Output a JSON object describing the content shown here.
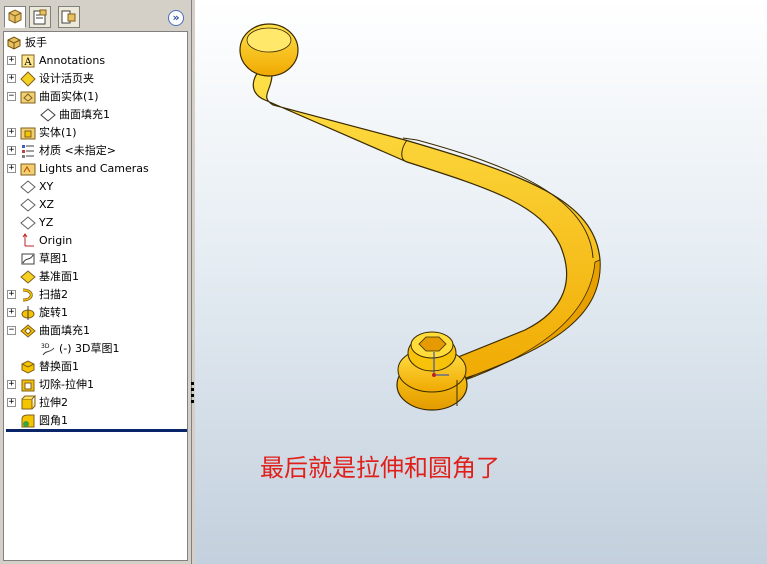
{
  "tabs": [
    {
      "icon": "feature-tree-icon"
    },
    {
      "icon": "property-manager-icon"
    },
    {
      "icon": "configuration-manager-icon"
    }
  ],
  "collapse_label": "»",
  "tree": {
    "root": "扳手",
    "items": [
      {
        "label": "Annotations",
        "expander": "+",
        "icon": "annotations-icon"
      },
      {
        "label": "设计活页夹",
        "expander": "+",
        "icon": "design-binder-icon"
      },
      {
        "label": "曲面实体(1)",
        "expander": "−",
        "icon": "surface-bodies-icon"
      },
      {
        "label": "曲面填充1",
        "expander": "",
        "icon": "surface-fill-icon"
      },
      {
        "label": "实体(1)",
        "expander": "+",
        "icon": "solid-bodies-icon"
      },
      {
        "label": "材质 <未指定>",
        "expander": "+",
        "icon": "material-icon"
      },
      {
        "label": "Lights and Cameras",
        "expander": "+",
        "icon": "lights-cameras-icon"
      },
      {
        "label": "XY",
        "expander": "",
        "icon": "plane-icon"
      },
      {
        "label": "XZ",
        "expander": "",
        "icon": "plane-icon"
      },
      {
        "label": "YZ",
        "expander": "",
        "icon": "plane-icon"
      },
      {
        "label": "Origin",
        "expander": "",
        "icon": "origin-icon"
      },
      {
        "label": "草图1",
        "expander": "",
        "icon": "sketch-icon"
      },
      {
        "label": "基准面1",
        "expander": "",
        "icon": "reference-plane-icon"
      },
      {
        "label": "扫描2",
        "expander": "+",
        "icon": "sweep-icon"
      },
      {
        "label": "旋转1",
        "expander": "+",
        "icon": "revolve-icon"
      },
      {
        "label": "曲面填充1",
        "expander": "−",
        "icon": "surface-fill-feature-icon"
      },
      {
        "label": "(-) 3D草图1",
        "expander": "",
        "icon": "3d-sketch-icon"
      },
      {
        "label": "替换面1",
        "expander": "",
        "icon": "replace-face-icon"
      },
      {
        "label": "切除-拉伸1",
        "expander": "+",
        "icon": "cut-extrude-icon"
      },
      {
        "label": "拉伸2",
        "expander": "+",
        "icon": "extrude-icon"
      },
      {
        "label": "圆角1",
        "expander": "",
        "icon": "fillet-icon"
      }
    ]
  },
  "viewport": {
    "annotation": "最后就是拉伸和圆角了",
    "annotation_color": "#e0201a",
    "model_color": "#f5c400"
  }
}
